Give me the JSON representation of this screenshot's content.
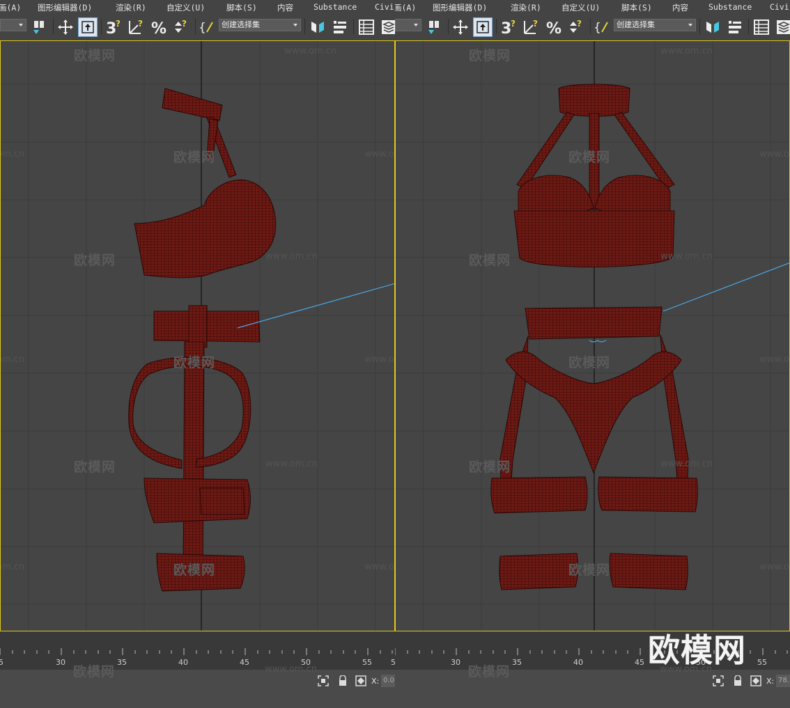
{
  "left": {
    "menu": [
      "画(A)",
      "图形编辑器(D)",
      "渲染(R)",
      "自定义(U)",
      "脚本(S)",
      "内容",
      "Substance",
      "Civi"
    ],
    "selection_set": "创建选择集",
    "timeline_ticks": [
      "5",
      "30",
      "35",
      "40",
      "45",
      "50",
      "55",
      "5"
    ],
    "coord_x_label": "X:",
    "coord_x_value": "0.0"
  },
  "right": {
    "menu": [
      "画(A)",
      "图形编辑器(D)",
      "渲染(R)",
      "自定义(U)",
      "脚本(S)",
      "内容",
      "Substance",
      "Civi"
    ],
    "selection_set": "创建选择集",
    "timeline_ticks": [
      "30",
      "35",
      "40",
      "45",
      "50",
      "55"
    ],
    "coord_x_label": "X:",
    "coord_x_value": "78."
  },
  "watermark": {
    "brand": "欧模网",
    "url": "www.om.cn",
    "url_short": "om.cn"
  },
  "colors": {
    "viewport_border": "#e0c81c",
    "mesh_fill": "#6e1a14",
    "mesh_wire": "#2a0605",
    "selection_line": "#4aa8e8",
    "background": "#444444"
  }
}
